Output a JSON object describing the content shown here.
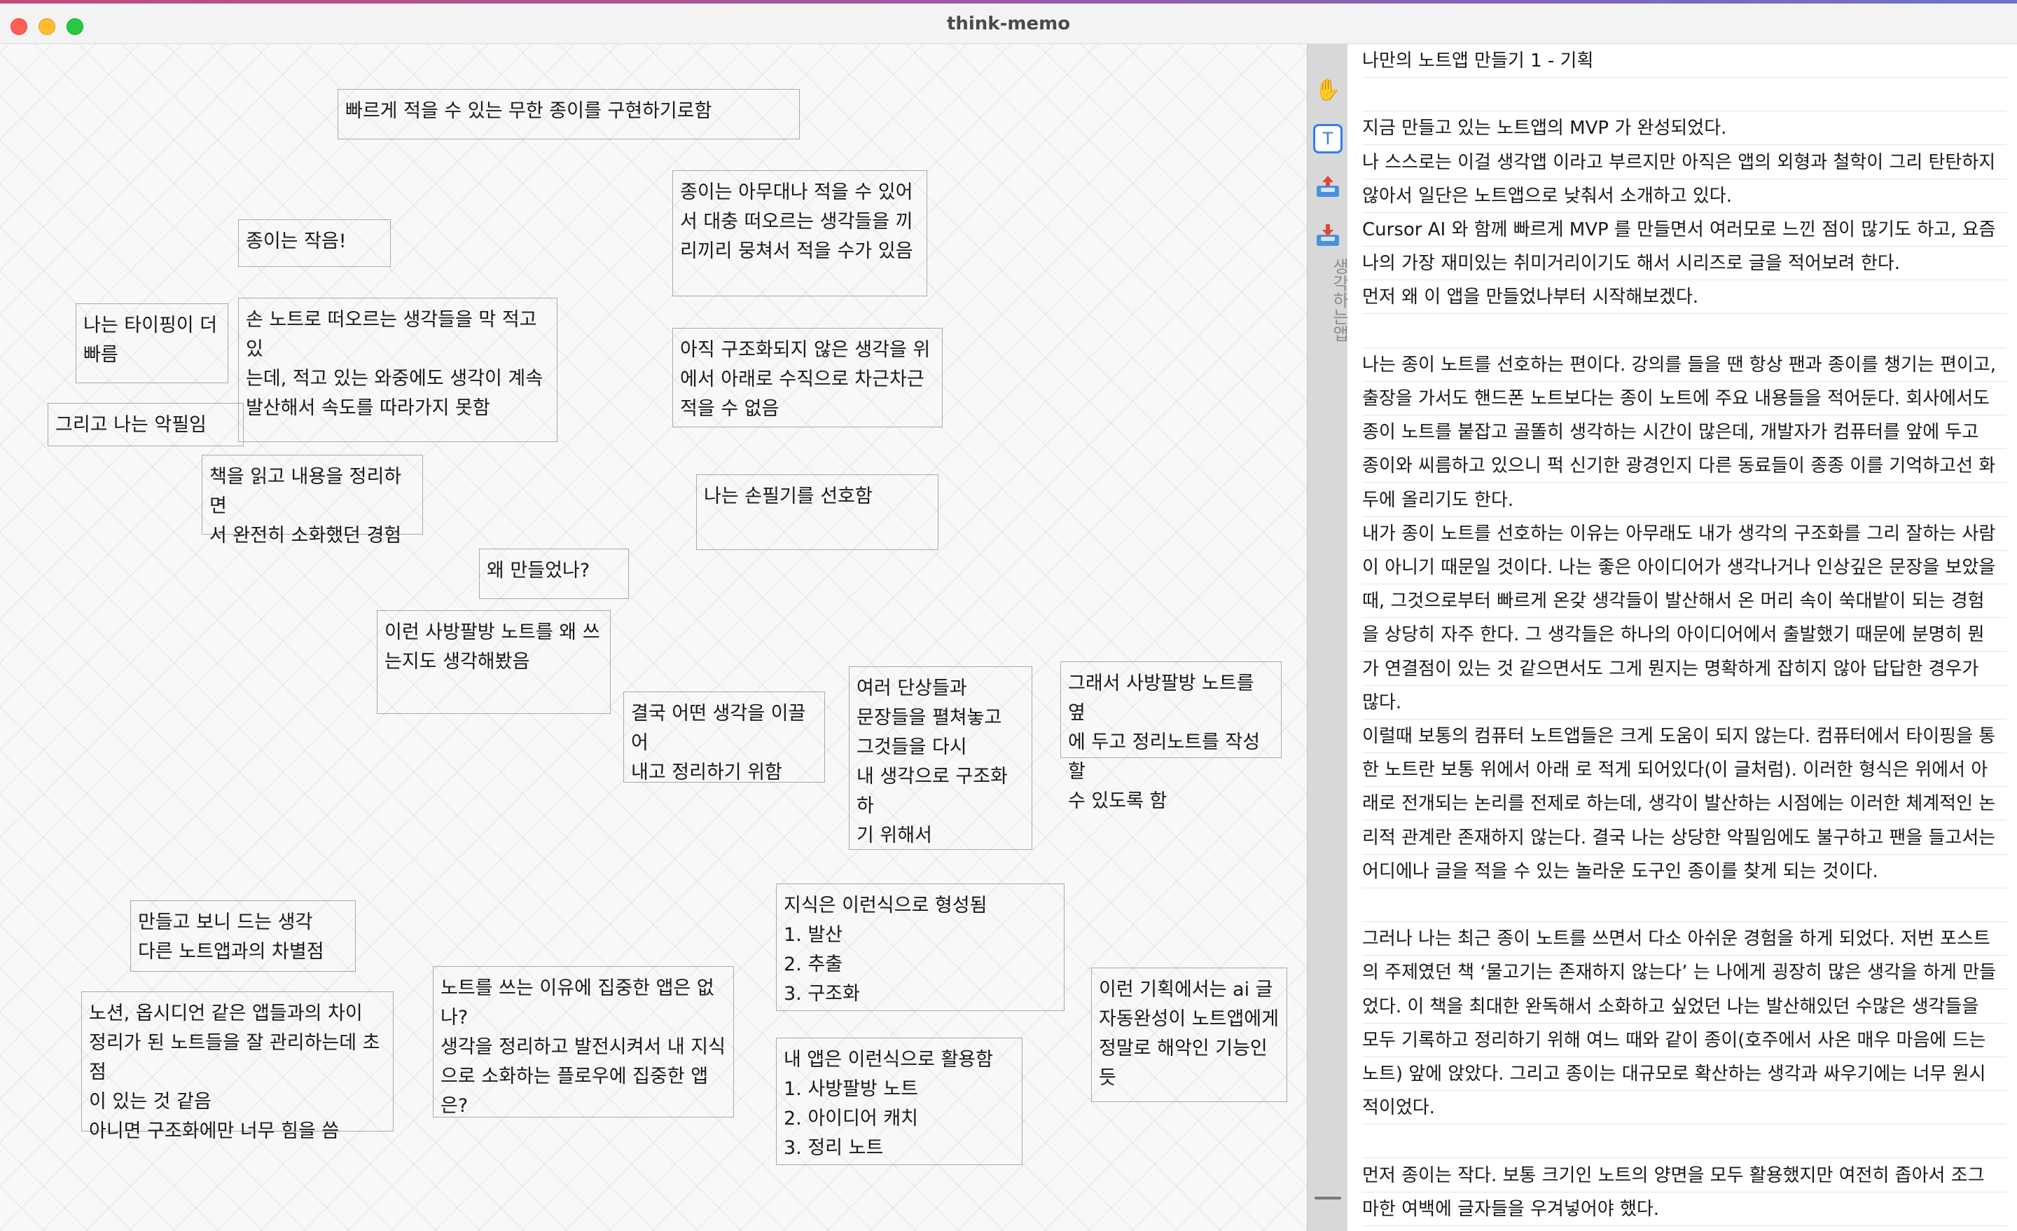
{
  "window": {
    "title": "think-memo"
  },
  "notes": [
    {
      "text": "빠르게 적을 수 있는 무한 종이를 구현하기로함"
    },
    {
      "text": "종이는 아무대나 적을 수 있어\n서 대충 떠오르는 생각들을 끼\n리끼리 뭉쳐서 적을 수가 있음"
    },
    {
      "text": "종이는 작음!"
    },
    {
      "text": "나는 타이핑이 더\n빠름"
    },
    {
      "text": "손 노트로 떠오르는 생각들을 막 적고 있\n는데, 적고 있는 와중에도 생각이 계속\n발산해서 속도를 따라가지 못함"
    },
    {
      "text": "아직 구조화되지 않은 생각을 위\n에서 아래로 수직으로 차근차근\n적을 수 없음"
    },
    {
      "text": "그리고 나는 악필임"
    },
    {
      "text": "책을 읽고 내용을 정리하면\n서 완전히 소화했던 경험"
    },
    {
      "text": "나는 손필기를 선호함"
    },
    {
      "text": "왜 만들었나?"
    },
    {
      "text": "이런 사방팔방 노트를 왜 쓰\n는지도 생각해봤음"
    },
    {
      "text": "결국 어떤 생각을 이끌어\n내고 정리하기 위함"
    },
    {
      "text": "여러 단상들과\n문장들을 펼쳐놓고\n그것들을 다시\n내 생각으로 구조화하\n기 위해서"
    },
    {
      "text": "그래서 사방팔방 노트를 옆\n에 두고 정리노트를 작성할\n수 있도록 함"
    },
    {
      "text": "만들고 보니 드는 생각\n다른 노트앱과의 차별점"
    },
    {
      "text": "지식은 이런식으로 형성됨\n1. 발산\n2. 추출\n3. 구조화"
    },
    {
      "text": "노션, 옵시디언 같은 앱들과의 차이\n정리가 된 노트들을 잘 관리하는데 초점\n이 있는 것 같음\n아니면 구조화에만 너무 힘을 씀"
    },
    {
      "text": "노트를 쓰는 이유에 집중한 앱은 없\n나?\n생각을 정리하고 발전시켜서 내 지식\n으로 소화하는 플로우에 집중한 앱은?"
    },
    {
      "text": "이런 기획에서는 ai 글\n자동완성이 노트앱에게\n정말로 해악인 기능인\n듯"
    },
    {
      "text": "내 앱은 이런식으로 활용함\n1. 사방팔방 노트\n2. 아이디어 캐치\n3. 정리 노트"
    }
  ],
  "toolbar": {
    "tools": [
      {
        "name": "hand-tool",
        "icon": "hand-icon",
        "glyph": "✋"
      },
      {
        "name": "text-tool",
        "icon": "text-icon",
        "glyph": "T"
      },
      {
        "name": "export-tool",
        "icon": "tray-upload-icon"
      },
      {
        "name": "import-tool",
        "icon": "tray-download-icon"
      }
    ],
    "vertical_label": "생각하는앱",
    "accent": "#2f7ff0"
  },
  "editor": {
    "lines": [
      "나만의 노트앱 만들기 1 - 기획",
      "",
      "지금 만들고 있는 노트앱의 MVP 가 완성되었다.",
      "나 스스로는 이걸 생각앱 이라고 부르지만 아직은 앱의 외형과 철학이 그리 탄탄하지",
      "않아서 일단은 노트앱으로 낮춰서 소개하고 있다.",
      "Cursor AI 와 함께 빠르게 MVP 를 만들면서 여러모로 느낀 점이 많기도 하고, 요즘",
      "나의 가장 재미있는 취미거리이기도 해서 시리즈로 글을 적어보려 한다.",
      "먼저 왜 이 앱을 만들었나부터 시작해보겠다.",
      "",
      "나는 종이 노트를 선호하는 편이다. 강의를 들을 땐 항상 팬과 종이를 챙기는 편이고,",
      "출장을 가서도 핸드폰 노트보다는 종이 노트에 주요 내용들을 적어둔다. 회사에서도",
      "종이 노트를 붙잡고 골똘히 생각하는 시간이 많은데, 개발자가 컴퓨터를 앞에 두고",
      "종이와 씨름하고 있으니 퍽 신기한 광경인지 다른 동료들이 종종 이를 기억하고선 화",
      "두에 올리기도 한다.",
      "내가 종이 노트를 선호하는 이유는 아무래도 내가 생각의 구조화를 그리 잘하는 사람",
      "이 아니기 때문일 것이다. 나는 좋은 아이디어가 생각나거나 인상깊은 문장을 보았을",
      "때, 그것으로부터 빠르게 온갖 생각들이 발산해서 온 머리 속이 쑥대밭이 되는 경험",
      "을 상당히 자주 한다. 그 생각들은 하나의 아이디어에서 출발했기 때문에 분명히 뭔",
      "가 연결점이 있는 것 같으면서도 그게 뭔지는 명확하게 잡히지 않아 답답한 경우가",
      "많다.",
      "이럴때 보통의 컴퓨터 노트앱들은 크게 도움이 되지 않는다. 컴퓨터에서 타이핑을 통",
      "한 노트란 보통 위에서 아래 로 적게 되어있다(이 글처럼). 이러한 형식은 위에서 아",
      "래로 전개되는 논리를 전제로 하는데, 생각이 발산하는 시점에는 이러한 체계적인 논",
      "리적 관계란 존재하지 않는다. 결국 나는 상당한 악필임에도 불구하고 팬을 들고서는",
      "어디에나 글을 적을 수 있는 놀라운 도구인 종이를 찾게 되는 것이다.",
      "",
      "그러나 나는 최근 종이 노트를 쓰면서 다소 아쉬운 경험을 하게 되었다. 저번 포스트",
      "의 주제였던 책 ‘물고기는 존재하지 않는다’ 는 나에게 굉장히 많은 생각을 하게 만들",
      "었다. 이 책을 최대한 완독해서 소화하고 싶었던 나는 발산해있던 수많은 생각들을",
      "모두 기록하고 정리하기 위해 여느 때와 같이 종이(호주에서 사온 매우 마음에 드는",
      "노트) 앞에 앉았다. 그리고 종이는 대규모로 확산하는 생각과 싸우기에는 너무 원시",
      "적이었다.",
      "",
      "먼저 종이는 작다. 보통 크기인 노트의 양면을 모두 활용했지만 여전히 좁아서 조그",
      "마한 여백에 글자들을 우겨넣어야 했다."
    ]
  }
}
